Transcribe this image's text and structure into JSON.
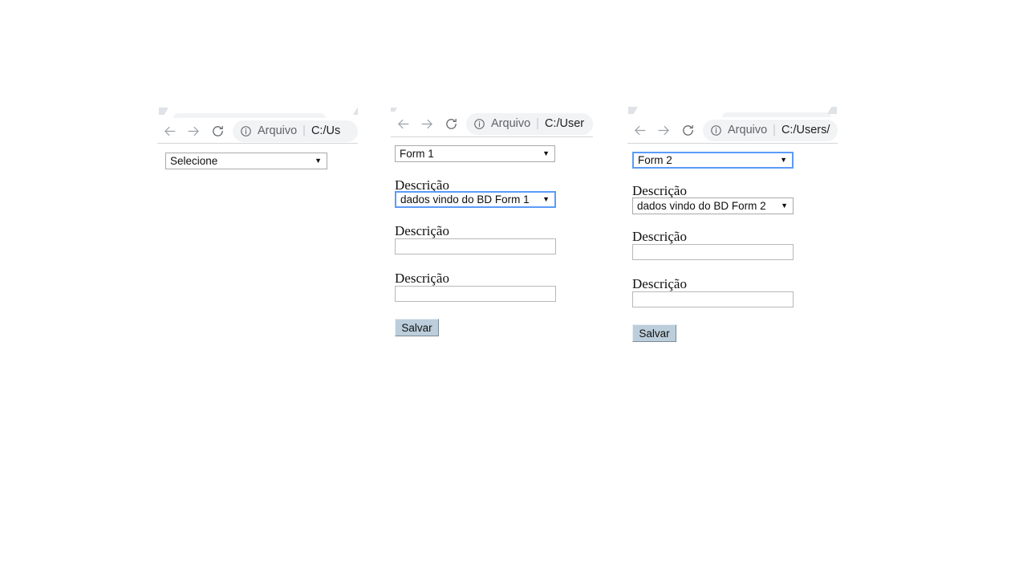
{
  "page": {
    "background": "#ffffff",
    "accent_focus_color": "#5b9bf8",
    "button_color": "#bccedb",
    "omnibox_color": "#f1f3f4"
  },
  "browser_chrome": {
    "back_icon": "arrow-left-icon",
    "forward_icon": "arrow-right-icon",
    "reload_icon": "reload-icon",
    "site_info_icon": "info-circle-icon",
    "site_info_label": "Arquivo",
    "separator": "|"
  },
  "panels": [
    {
      "id": "panel-1",
      "url_text": "C:/Us",
      "select_main": {
        "value": "Selecione",
        "focused": false,
        "caret": "▼"
      },
      "fields": [],
      "button": null
    },
    {
      "id": "panel-2",
      "url_text": "C:/User",
      "select_main": {
        "value": "Form 1",
        "focused": false,
        "caret": "▼"
      },
      "fields": [
        {
          "label": "Descrição",
          "type": "select",
          "value": "dados vindo do BD Form 1",
          "focused": true,
          "caret": "▼"
        },
        {
          "label": "Descrição",
          "type": "text",
          "value": "",
          "focused": false
        },
        {
          "label": "Descrição",
          "type": "text",
          "value": "",
          "focused": false
        }
      ],
      "button": {
        "label": "Salvar"
      }
    },
    {
      "id": "panel-3",
      "url_text": "C:/Users/",
      "select_main": {
        "value": "Form 2",
        "focused": true,
        "caret": "▼"
      },
      "fields": [
        {
          "label": "Descrição",
          "type": "select",
          "value": "dados vindo do BD Form 2",
          "focused": false,
          "caret": "▼"
        },
        {
          "label": "Descrição",
          "type": "text",
          "value": "",
          "focused": false
        },
        {
          "label": "Descrição",
          "type": "text",
          "value": "",
          "focused": false
        }
      ],
      "button": {
        "label": "Salvar"
      }
    }
  ]
}
